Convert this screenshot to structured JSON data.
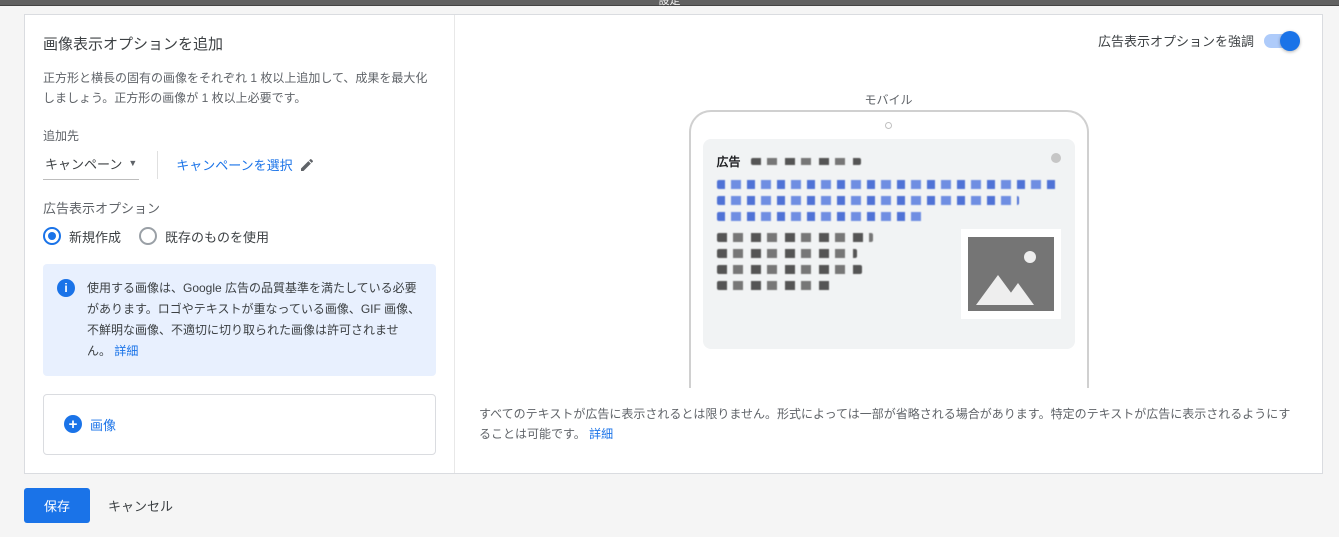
{
  "topbar": {
    "label": "設定"
  },
  "left": {
    "title": "画像表示オプションを追加",
    "desc": "正方形と横長の固有の画像をそれぞれ 1 枚以上追加して、成果を最大化しましょう。正方形の画像が 1 枚以上必要です。",
    "target_label": "追加先",
    "dropdown_value": "キャンペーン",
    "select_campaign": "キャンペーンを選択",
    "extension_label": "広告表示オプション",
    "radio_new": "新規作成",
    "radio_existing": "既存のものを使用",
    "info_text": "使用する画像は、Google 広告の品質基準を満たしている必要があります。ロゴやテキストが重なっている画像、GIF 画像、不鮮明な画像、不適切に切り取られた画像は許可されません。",
    "info_link": "詳細",
    "add_image": "画像"
  },
  "right": {
    "emphasize": "広告表示オプションを強調",
    "preview_label": "モバイル",
    "ad_label": "広告",
    "disclaimer": "すべてのテキストが広告に表示されるとは限りません。形式によっては一部が省略される場合があります。特定のテキストが広告に表示されるようにすることは可能です。",
    "disclaimer_link": "詳細"
  },
  "footer": {
    "save": "保存",
    "cancel": "キャンセル"
  }
}
